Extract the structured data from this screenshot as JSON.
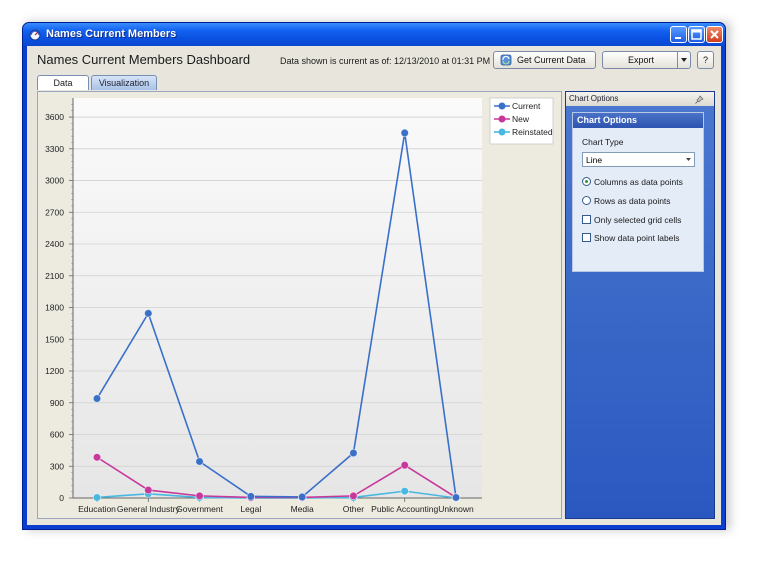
{
  "window": {
    "title": "Names Current Members",
    "controls": [
      "minimize",
      "maximize",
      "close"
    ]
  },
  "header": {
    "page_title": "Names Current Members Dashboard",
    "as_of": "Data shown is current as of: 12/13/2010 at 01:31 PM",
    "get_data_label": "Get Current Data",
    "export_label": "Export",
    "help_label": "?"
  },
  "tabs": [
    {
      "label": "Data"
    },
    {
      "label": "Visualization"
    }
  ],
  "chart_options": {
    "panel_title": "Chart Options",
    "section_title": "Chart Options",
    "chart_type_label": "Chart Type",
    "chart_type_value": "Line",
    "options": [
      {
        "label": "Columns as data points",
        "kind": "radio",
        "checked": true
      },
      {
        "label": "Rows as data points",
        "kind": "radio",
        "checked": false
      },
      {
        "label": "Only selected grid cells",
        "kind": "checkbox",
        "checked": false
      },
      {
        "label": "Show data point labels",
        "kind": "checkbox",
        "checked": false
      }
    ]
  },
  "chart_data": {
    "type": "line",
    "categories": [
      "Education",
      "General Industry",
      "Government",
      "Legal",
      "Media",
      "Other",
      "Public Accounting",
      "Unknown"
    ],
    "series": [
      {
        "name": "Current",
        "color": "#3a70c8",
        "values": [
          940,
          1745,
          345,
          15,
          10,
          425,
          3450,
          5
        ]
      },
      {
        "name": "New",
        "color": "#c8389a",
        "values": [
          385,
          75,
          20,
          5,
          5,
          20,
          310,
          5
        ]
      },
      {
        "name": "Reinstated",
        "color": "#48b8e0",
        "values": [
          5,
          40,
          5,
          0,
          0,
          5,
          65,
          0
        ]
      }
    ],
    "yticks": [
      0,
      300,
      600,
      900,
      1200,
      1500,
      1800,
      2100,
      2400,
      2700,
      3000,
      3300,
      3600
    ],
    "ylim": [
      0,
      3780
    ],
    "grid": true,
    "legend_position": "top-right"
  }
}
